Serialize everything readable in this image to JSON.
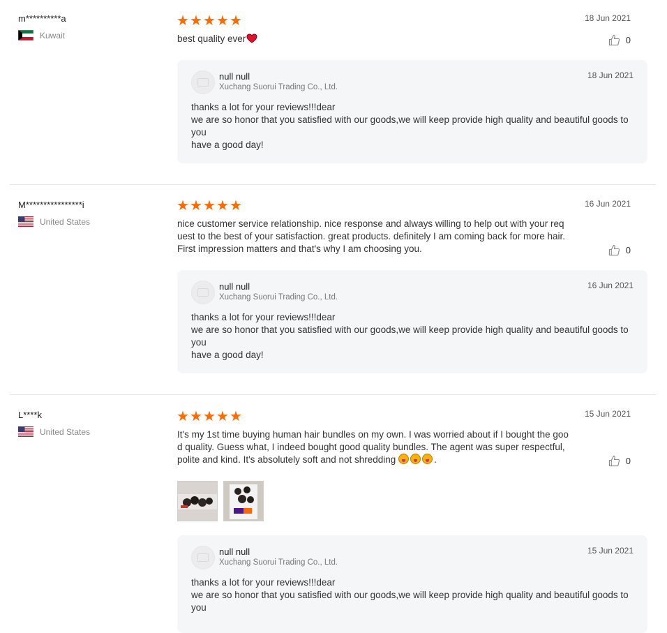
{
  "reviews": [
    {
      "user": "m**********a",
      "country": "Kuwait",
      "rating": 5,
      "date": "18 Jun 2021",
      "text": "best quality ever",
      "likes": "0",
      "reply": {
        "name": "null null",
        "company": "Xuchang Suorui Trading Co., Ltd.",
        "date": "18 Jun 2021",
        "lines": [
          "thanks a lot for your reviews!!!dear",
          "we are so honor that you satisfied with our goods,we will keep provide high quality and beautiful goods to you",
          "have a good day!"
        ]
      }
    },
    {
      "user": "M****************i",
      "country": "United States",
      "rating": 5,
      "date": "16 Jun 2021",
      "text": "nice customer service relationship. nice response and always willing to help out with your request to the best of your satisfaction. great products. definitely I am coming back for more hair. First impression matters and that's why I am choosing you.",
      "likes": "0",
      "reply": {
        "name": "null null",
        "company": "Xuchang Suorui Trading Co., Ltd.",
        "date": "16 Jun 2021",
        "lines": [
          "thanks a lot for your reviews!!!dear",
          "we are so honor that you satisfied with our goods,we will keep provide high quality and beautiful goods to you",
          "have a good day!"
        ]
      }
    },
    {
      "user": "L****k",
      "country": "United States",
      "rating": 5,
      "date": "15 Jun 2021",
      "text": "It's my 1st time buying human hair bundles on my own. I was worried about if I bought the good quality. Guess what, I indeed bought good quality bundles. The agent was super respectful, polite and kind. It's absolutely soft and not shredding",
      "text_end": ".",
      "likes": "0",
      "photos": [
        "hair-bundles-photo",
        "fedex-package-photo"
      ],
      "reply": {
        "name": "null null",
        "company": "Xuchang Suorui Trading Co., Ltd.",
        "date": "15 Jun 2021",
        "lines": [
          "thanks a lot for your reviews!!!dear",
          "we are so honor that you satisfied with our goods,we will keep provide high quality and beautiful goods to you"
        ]
      }
    }
  ],
  "colors": {
    "star": "#ff6a00",
    "reply_bg": "#f5f6f8",
    "divider": "#e6e6e6"
  },
  "icons": {
    "rating": "star-icon",
    "like": "thumbs-up-icon",
    "heart": "heart-icon",
    "emoji": "tongue-out-face-icon"
  }
}
